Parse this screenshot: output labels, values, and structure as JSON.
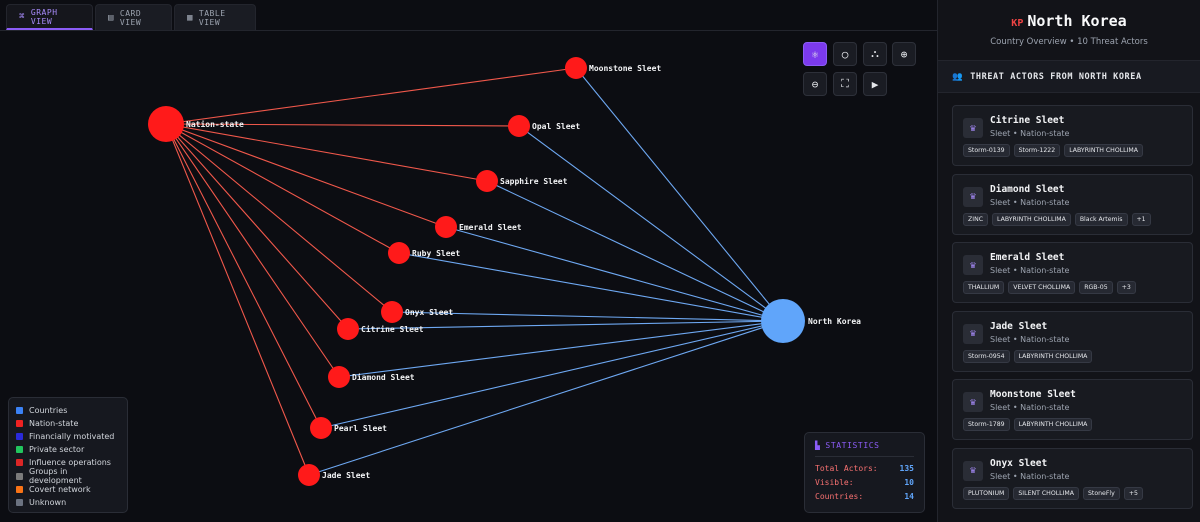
{
  "tabs": [
    {
      "label": "GRAPH VIEW",
      "icon": "graph-icon",
      "active": true
    },
    {
      "label": "CARD VIEW",
      "icon": "card-icon",
      "active": false
    },
    {
      "label": "TABLE VIEW",
      "icon": "table-icon",
      "active": false
    }
  ],
  "graph": {
    "hub": {
      "label": "Nation-state",
      "color": "#ff1a1a"
    },
    "country": {
      "label": "North Korea",
      "color": "#60a5fa"
    },
    "actors": [
      "Moonstone Sleet",
      "Opal Sleet",
      "Sapphire Sleet",
      "Emerald Sleet",
      "Ruby Sleet",
      "Onyx Sleet",
      "Citrine Sleet",
      "Diamond Sleet",
      "Pearl Sleet",
      "Jade Sleet"
    ],
    "actor_color": "#ff1a1a",
    "red_edge_color": "#f0584b",
    "blue_edge_color": "#6ea8f2"
  },
  "toolbar": {
    "buttons": [
      {
        "icon": "network-icon",
        "active": true
      },
      {
        "icon": "circle-layout-icon",
        "active": false
      },
      {
        "icon": "hierarchy-icon",
        "active": false
      },
      {
        "icon": "zoom-in-icon",
        "active": false
      },
      {
        "icon": "zoom-out-icon",
        "active": false
      },
      {
        "icon": "fit-screen-icon",
        "active": false
      },
      {
        "icon": "play-icon",
        "active": false
      }
    ]
  },
  "legend": [
    {
      "label": "Countries",
      "color": "#3b82f6"
    },
    {
      "label": "Nation-state",
      "color": "#ef2222"
    },
    {
      "label": "Financially motivated",
      "color": "#2a2adb"
    },
    {
      "label": "Private sector",
      "color": "#22c55e"
    },
    {
      "label": "Influence operations",
      "color": "#dc2626"
    },
    {
      "label": "Groups in development",
      "color": "#7b7b7b"
    },
    {
      "label": "Covert network",
      "color": "#f97316"
    },
    {
      "label": "Unknown",
      "color": "#6b7280"
    }
  ],
  "stats": {
    "title": "STATISTICS",
    "rows": [
      {
        "label": "Total Actors:",
        "value": "135"
      },
      {
        "label": "Visible:",
        "value": "10"
      },
      {
        "label": "Countries:",
        "value": "14"
      }
    ]
  },
  "panel": {
    "country_code": "KP",
    "title": "North Korea",
    "subtitle": "Country Overview • 10 Threat Actors",
    "section_title": "THREAT ACTORS FROM NORTH KOREA",
    "cards": [
      {
        "name": "Citrine Sleet",
        "meta": "Sleet • Nation-state",
        "tags": [
          "Storm-0139",
          "Storm-1222",
          "LABYRINTH CHOLLIMA"
        ]
      },
      {
        "name": "Diamond Sleet",
        "meta": "Sleet • Nation-state",
        "tags": [
          "ZINC",
          "LABYRINTH CHOLLIMA",
          "Black Artemis",
          "+1"
        ]
      },
      {
        "name": "Emerald Sleet",
        "meta": "Sleet • Nation-state",
        "tags": [
          "THALLIUM",
          "VELVET CHOLLIMA",
          "RGB-05",
          "+3"
        ]
      },
      {
        "name": "Jade Sleet",
        "meta": "Sleet • Nation-state",
        "tags": [
          "Storm-0954",
          "LABYRINTH CHOLLIMA"
        ]
      },
      {
        "name": "Moonstone Sleet",
        "meta": "Sleet • Nation-state",
        "tags": [
          "Storm-1789",
          "LABYRINTH CHOLLIMA"
        ]
      },
      {
        "name": "Onyx Sleet",
        "meta": "Sleet • Nation-state",
        "tags": [
          "PLUTONIUM",
          "SILENT CHOLLIMA",
          "StoneFly",
          "+5"
        ]
      }
    ]
  }
}
